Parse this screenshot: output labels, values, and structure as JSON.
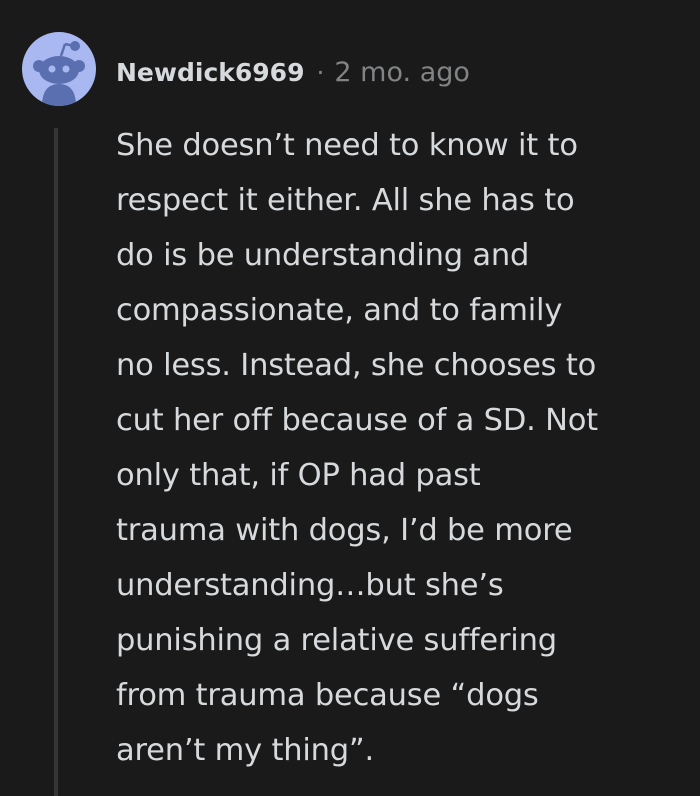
{
  "comment": {
    "author": "Newdick6969",
    "separator": "·",
    "timestamp": "2 mo. ago",
    "avatar_icon": "snoo-avatar-icon",
    "avatar_bg": "#a9b8f0",
    "body_lines": [
      "She doesn’t need to know it to",
      "respect it either. All she has to",
      "do is be understanding and",
      "compassionate, and to family",
      "no less. Instead, she chooses to",
      "cut her off because of a SD. Not",
      "only that, if OP had past",
      "trauma with dogs, I’d be more",
      "understanding…but she’s",
      "punishing a relative suffering",
      "from trauma because “dogs",
      "aren’t my thing”."
    ]
  }
}
